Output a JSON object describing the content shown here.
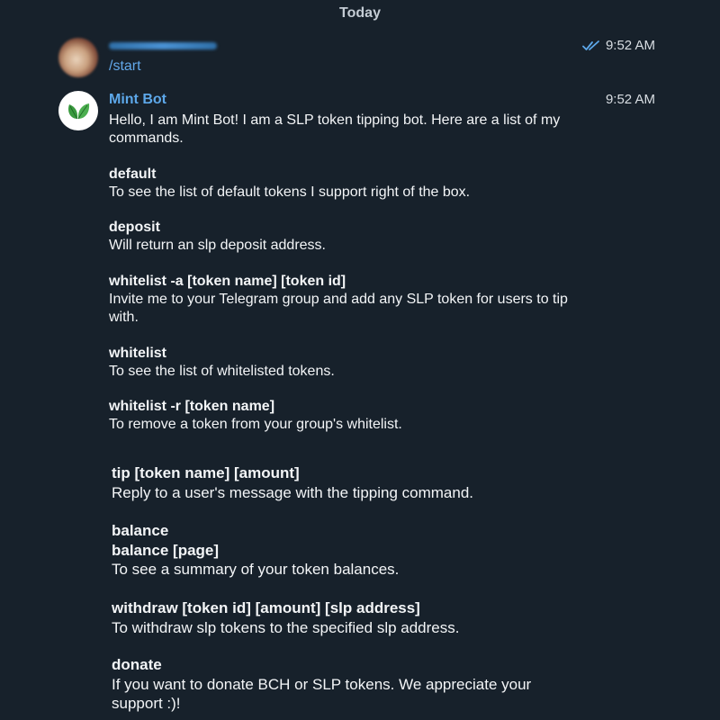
{
  "date_header": "Today",
  "user_message": {
    "text": "/start",
    "time": "9:52 AM"
  },
  "bot_message": {
    "name": "Mint Bot",
    "time": "9:52 AM",
    "intro": "Hello, I am Mint Bot! I am a SLP token tipping bot. Here are a list of my commands.",
    "commands": [
      {
        "name": "default",
        "desc": "To see the list of default tokens I support right of the box."
      },
      {
        "name": "deposit",
        "desc": "Will return an slp deposit address."
      },
      {
        "name": "whitelist -a [token name] [token id]",
        "desc": "Invite me to your Telegram group and add any SLP token for users to tip with."
      },
      {
        "name": "whitelist",
        "desc": "To see the list of whitelisted tokens."
      },
      {
        "name": "whitelist -r [token name]",
        "desc": "To remove a token from your group's whitelist."
      },
      {
        "name": "tip [token name] [amount]",
        "desc": "Reply to a user's message with the tipping command."
      },
      {
        "name": "balance",
        "name2": "balance [page]",
        "desc": "To see a summary of your token balances."
      },
      {
        "name": "withdraw [token id] [amount] [slp address]",
        "desc": "To withdraw slp tokens to the specified slp address."
      },
      {
        "name": "donate",
        "desc": "If you want to donate BCH or SLP tokens. We appreciate your support :)!"
      }
    ]
  },
  "icons": {
    "read_receipt": "double-check-icon",
    "bot_avatar": "leaf-icon"
  },
  "colors": {
    "background": "#17212b",
    "link": "#62a8ea",
    "text": "#f3f5f7",
    "leaf": "#3a9a3f"
  }
}
